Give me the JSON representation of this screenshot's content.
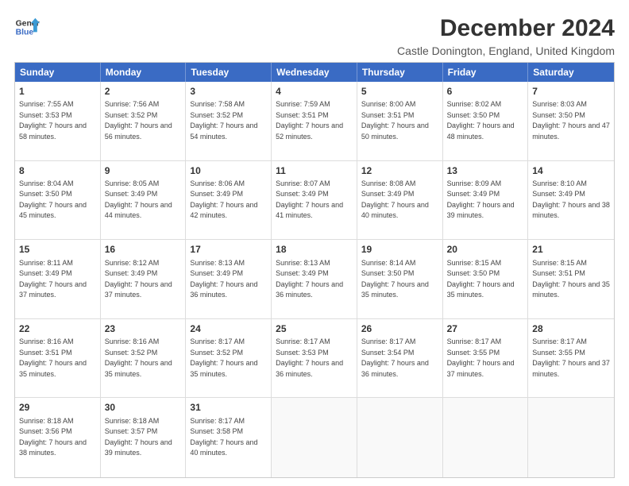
{
  "header": {
    "logo_line1": "General",
    "logo_line2": "Blue",
    "main_title": "December 2024",
    "subtitle": "Castle Donington, England, United Kingdom"
  },
  "calendar": {
    "days_of_week": [
      "Sunday",
      "Monday",
      "Tuesday",
      "Wednesday",
      "Thursday",
      "Friday",
      "Saturday"
    ],
    "rows": [
      [
        {
          "day": "1",
          "sunrise": "Sunrise: 7:55 AM",
          "sunset": "Sunset: 3:53 PM",
          "daylight": "Daylight: 7 hours and 58 minutes."
        },
        {
          "day": "2",
          "sunrise": "Sunrise: 7:56 AM",
          "sunset": "Sunset: 3:52 PM",
          "daylight": "Daylight: 7 hours and 56 minutes."
        },
        {
          "day": "3",
          "sunrise": "Sunrise: 7:58 AM",
          "sunset": "Sunset: 3:52 PM",
          "daylight": "Daylight: 7 hours and 54 minutes."
        },
        {
          "day": "4",
          "sunrise": "Sunrise: 7:59 AM",
          "sunset": "Sunset: 3:51 PM",
          "daylight": "Daylight: 7 hours and 52 minutes."
        },
        {
          "day": "5",
          "sunrise": "Sunrise: 8:00 AM",
          "sunset": "Sunset: 3:51 PM",
          "daylight": "Daylight: 7 hours and 50 minutes."
        },
        {
          "day": "6",
          "sunrise": "Sunrise: 8:02 AM",
          "sunset": "Sunset: 3:50 PM",
          "daylight": "Daylight: 7 hours and 48 minutes."
        },
        {
          "day": "7",
          "sunrise": "Sunrise: 8:03 AM",
          "sunset": "Sunset: 3:50 PM",
          "daylight": "Daylight: 7 hours and 47 minutes."
        }
      ],
      [
        {
          "day": "8",
          "sunrise": "Sunrise: 8:04 AM",
          "sunset": "Sunset: 3:50 PM",
          "daylight": "Daylight: 7 hours and 45 minutes."
        },
        {
          "day": "9",
          "sunrise": "Sunrise: 8:05 AM",
          "sunset": "Sunset: 3:49 PM",
          "daylight": "Daylight: 7 hours and 44 minutes."
        },
        {
          "day": "10",
          "sunrise": "Sunrise: 8:06 AM",
          "sunset": "Sunset: 3:49 PM",
          "daylight": "Daylight: 7 hours and 42 minutes."
        },
        {
          "day": "11",
          "sunrise": "Sunrise: 8:07 AM",
          "sunset": "Sunset: 3:49 PM",
          "daylight": "Daylight: 7 hours and 41 minutes."
        },
        {
          "day": "12",
          "sunrise": "Sunrise: 8:08 AM",
          "sunset": "Sunset: 3:49 PM",
          "daylight": "Daylight: 7 hours and 40 minutes."
        },
        {
          "day": "13",
          "sunrise": "Sunrise: 8:09 AM",
          "sunset": "Sunset: 3:49 PM",
          "daylight": "Daylight: 7 hours and 39 minutes."
        },
        {
          "day": "14",
          "sunrise": "Sunrise: 8:10 AM",
          "sunset": "Sunset: 3:49 PM",
          "daylight": "Daylight: 7 hours and 38 minutes."
        }
      ],
      [
        {
          "day": "15",
          "sunrise": "Sunrise: 8:11 AM",
          "sunset": "Sunset: 3:49 PM",
          "daylight": "Daylight: 7 hours and 37 minutes."
        },
        {
          "day": "16",
          "sunrise": "Sunrise: 8:12 AM",
          "sunset": "Sunset: 3:49 PM",
          "daylight": "Daylight: 7 hours and 37 minutes."
        },
        {
          "day": "17",
          "sunrise": "Sunrise: 8:13 AM",
          "sunset": "Sunset: 3:49 PM",
          "daylight": "Daylight: 7 hours and 36 minutes."
        },
        {
          "day": "18",
          "sunrise": "Sunrise: 8:13 AM",
          "sunset": "Sunset: 3:49 PM",
          "daylight": "Daylight: 7 hours and 36 minutes."
        },
        {
          "day": "19",
          "sunrise": "Sunrise: 8:14 AM",
          "sunset": "Sunset: 3:50 PM",
          "daylight": "Daylight: 7 hours and 35 minutes."
        },
        {
          "day": "20",
          "sunrise": "Sunrise: 8:15 AM",
          "sunset": "Sunset: 3:50 PM",
          "daylight": "Daylight: 7 hours and 35 minutes."
        },
        {
          "day": "21",
          "sunrise": "Sunrise: 8:15 AM",
          "sunset": "Sunset: 3:51 PM",
          "daylight": "Daylight: 7 hours and 35 minutes."
        }
      ],
      [
        {
          "day": "22",
          "sunrise": "Sunrise: 8:16 AM",
          "sunset": "Sunset: 3:51 PM",
          "daylight": "Daylight: 7 hours and 35 minutes."
        },
        {
          "day": "23",
          "sunrise": "Sunrise: 8:16 AM",
          "sunset": "Sunset: 3:52 PM",
          "daylight": "Daylight: 7 hours and 35 minutes."
        },
        {
          "day": "24",
          "sunrise": "Sunrise: 8:17 AM",
          "sunset": "Sunset: 3:52 PM",
          "daylight": "Daylight: 7 hours and 35 minutes."
        },
        {
          "day": "25",
          "sunrise": "Sunrise: 8:17 AM",
          "sunset": "Sunset: 3:53 PM",
          "daylight": "Daylight: 7 hours and 36 minutes."
        },
        {
          "day": "26",
          "sunrise": "Sunrise: 8:17 AM",
          "sunset": "Sunset: 3:54 PM",
          "daylight": "Daylight: 7 hours and 36 minutes."
        },
        {
          "day": "27",
          "sunrise": "Sunrise: 8:17 AM",
          "sunset": "Sunset: 3:55 PM",
          "daylight": "Daylight: 7 hours and 37 minutes."
        },
        {
          "day": "28",
          "sunrise": "Sunrise: 8:17 AM",
          "sunset": "Sunset: 3:55 PM",
          "daylight": "Daylight: 7 hours and 37 minutes."
        }
      ],
      [
        {
          "day": "29",
          "sunrise": "Sunrise: 8:18 AM",
          "sunset": "Sunset: 3:56 PM",
          "daylight": "Daylight: 7 hours and 38 minutes."
        },
        {
          "day": "30",
          "sunrise": "Sunrise: 8:18 AM",
          "sunset": "Sunset: 3:57 PM",
          "daylight": "Daylight: 7 hours and 39 minutes."
        },
        {
          "day": "31",
          "sunrise": "Sunrise: 8:17 AM",
          "sunset": "Sunset: 3:58 PM",
          "daylight": "Daylight: 7 hours and 40 minutes."
        },
        {
          "day": "",
          "sunrise": "",
          "sunset": "",
          "daylight": ""
        },
        {
          "day": "",
          "sunrise": "",
          "sunset": "",
          "daylight": ""
        },
        {
          "day": "",
          "sunrise": "",
          "sunset": "",
          "daylight": ""
        },
        {
          "day": "",
          "sunrise": "",
          "sunset": "",
          "daylight": ""
        }
      ]
    ]
  }
}
